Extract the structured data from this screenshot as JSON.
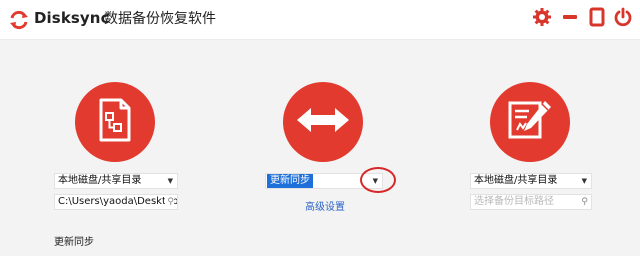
{
  "app": {
    "name": "Disksync",
    "subtitle": "数据备份恢复软件",
    "accent": "#e23a2e"
  },
  "titlebar": {
    "icons": [
      "gear-icon",
      "minimize-icon",
      "maximize-icon",
      "power-icon"
    ]
  },
  "source": {
    "icon": "document-diagram-icon",
    "select_value": "本地磁盘/共享目录",
    "path_value": "C:\\Users\\yaoda\\Desktop"
  },
  "mode": {
    "icon": "double-arrow-icon",
    "select_value": "更新同步",
    "advanced_label": "高级设置"
  },
  "target": {
    "icon": "edit-document-icon",
    "select_value": "本地磁盘/共享目录",
    "path_placeholder": "选择备份目标路径"
  },
  "status": {
    "text": "更新同步"
  }
}
